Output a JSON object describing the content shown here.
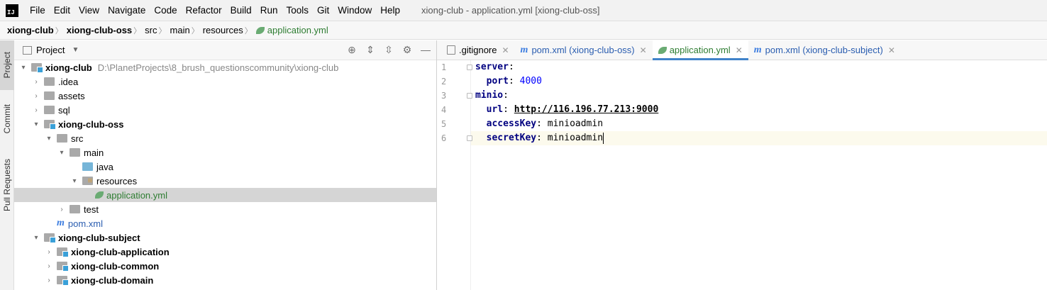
{
  "menubar": {
    "items": [
      "File",
      "Edit",
      "View",
      "Navigate",
      "Code",
      "Refactor",
      "Build",
      "Run",
      "Tools",
      "Git",
      "Window",
      "Help"
    ],
    "window_title": "xiong-club - application.yml [xiong-club-oss]"
  },
  "breadcrumb": [
    "xiong-club",
    "xiong-club-oss",
    "src",
    "main",
    "resources",
    "application.yml"
  ],
  "side_strip": {
    "project": "Project",
    "commit": "Commit",
    "pull_requests": "Pull Requests"
  },
  "project_panel": {
    "title": "Project",
    "tree": {
      "root_name": "xiong-club",
      "root_path": "D:\\PlanetProjects\\8_brush_questionscommunity\\xiong-club",
      "idea": ".idea",
      "assets": "assets",
      "sql": "sql",
      "oss": "xiong-club-oss",
      "src": "src",
      "main": "main",
      "java": "java",
      "resources": "resources",
      "application_yml": "application.yml",
      "test": "test",
      "pom": "pom.xml",
      "subject": "xiong-club-subject",
      "sub_application": "xiong-club-application",
      "sub_common": "xiong-club-common",
      "sub_domain": "xiong-club-domain"
    }
  },
  "editor": {
    "tabs": [
      {
        "label": ".gitignore"
      },
      {
        "label": "pom.xml (xiong-club-oss)"
      },
      {
        "label": "application.yml"
      },
      {
        "label": "pom.xml (xiong-club-subject)"
      }
    ],
    "line_numbers": [
      "1",
      "2",
      "3",
      "4",
      "5",
      "6"
    ],
    "code": {
      "l1_key": "server",
      "l2_key": "port",
      "l2_val": "4000",
      "l3_key": "minio",
      "l4_key": "url",
      "l4_val": "http://116.196.77.213:9000",
      "l5_key": "accessKey",
      "l5_val": "minioadmin",
      "l6_key": "secretKey",
      "l6_val": "minioadmin"
    }
  }
}
